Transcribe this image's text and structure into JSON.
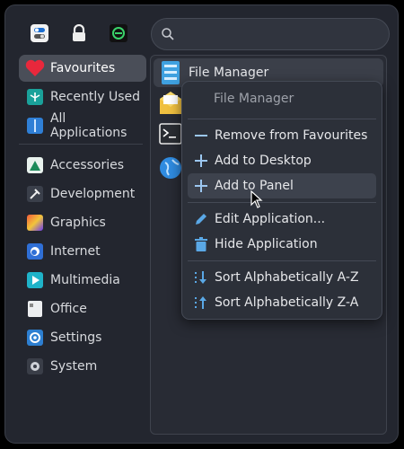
{
  "top_icons": [
    {
      "icon": "settings-toggle-icon"
    },
    {
      "icon": "lock-icon"
    },
    {
      "icon": "logout-icon"
    }
  ],
  "search": {
    "placeholder": ""
  },
  "sidebar": {
    "items": [
      {
        "label": "Favourites",
        "icon": "heart-icon",
        "active": true
      },
      {
        "label": "Recently Used",
        "icon": "recent-icon"
      },
      {
        "label": "All Applications",
        "icon": "all-apps-icon"
      },
      {
        "label": "Accessories",
        "icon": "accessories-icon"
      },
      {
        "label": "Development",
        "icon": "development-icon"
      },
      {
        "label": "Graphics",
        "icon": "graphics-icon"
      },
      {
        "label": "Internet",
        "icon": "internet-icon"
      },
      {
        "label": "Multimedia",
        "icon": "multimedia-icon"
      },
      {
        "label": "Office",
        "icon": "office-icon"
      },
      {
        "label": "Settings",
        "icon": "settings-icon"
      },
      {
        "label": "System",
        "icon": "system-icon"
      }
    ]
  },
  "apps": [
    {
      "label": "File Manager",
      "icon": "file-manager-icon"
    },
    {
      "label": "",
      "icon": "mail-icon"
    },
    {
      "label": "",
      "icon": "terminal-icon"
    },
    {
      "label": "",
      "icon": "web-browser-icon"
    }
  ],
  "context_menu": {
    "title": "File Manager",
    "items": [
      {
        "label": "Remove from Favourites",
        "icon": "minus-icon"
      },
      {
        "label": "Add to Desktop",
        "icon": "plus-icon"
      },
      {
        "label": "Add to Panel",
        "icon": "plus-icon",
        "hover": true
      },
      {
        "label": "Edit Application...",
        "icon": "pencil-icon"
      },
      {
        "label": "Hide Application",
        "icon": "trash-icon"
      },
      {
        "label": "Sort Alphabetically A-Z",
        "icon": "sort-down-icon"
      },
      {
        "label": "Sort Alphabetically Z-A",
        "icon": "sort-up-icon"
      }
    ]
  }
}
